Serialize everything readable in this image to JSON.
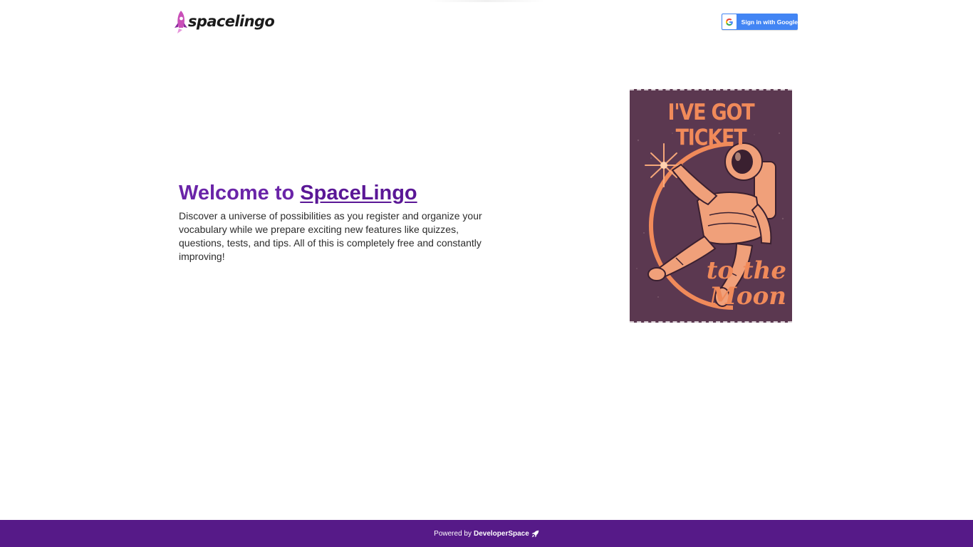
{
  "header": {
    "logo_text": "spacelingo",
    "signin_label": "Sign in with Google"
  },
  "hero": {
    "title_prefix": "Welcome to ",
    "title_brand": "SpaceLingo",
    "description": "Discover a universe of possibilities as you register and organize your vocabulary while we prepare exciting new features like quizzes, questions, tests, and tips. All of this is completely free and constantly improving!"
  },
  "poster": {
    "headline": "I'VE GOT TICKET",
    "script_line1": "to the",
    "script_line2": "Moon"
  },
  "footer": {
    "powered_label": "Powered by",
    "brand_label": "DeveloperSpace"
  },
  "colors": {
    "brand_purple": "#6a24a8",
    "footer_purple": "#561a88",
    "google_blue": "#4285f4",
    "poster_bg": "#5b3850",
    "poster_accent": "#f08a5a"
  },
  "icons": {
    "logo": "rocket-icon",
    "signin": "google-g-icon",
    "footer": "rocket-icon"
  }
}
